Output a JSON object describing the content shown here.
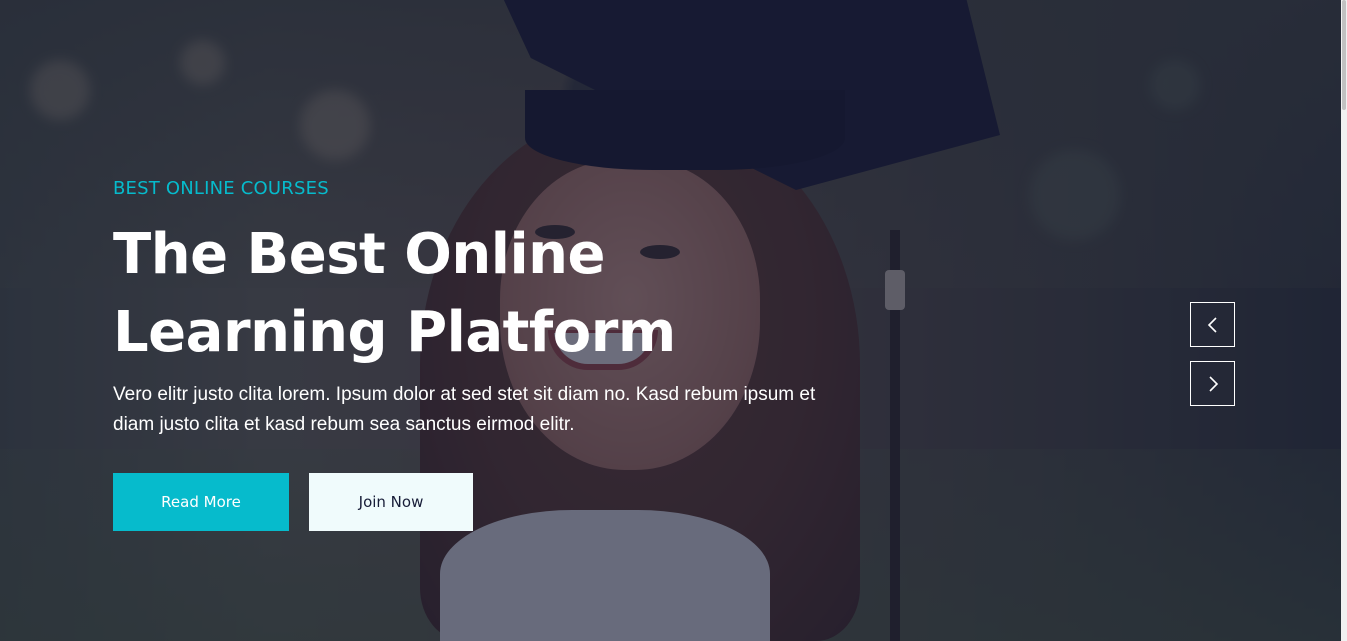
{
  "hero": {
    "eyebrow": "BEST ONLINE COURSES",
    "title": "The Best Online Learning Platform",
    "description": "Vero elitr justo clita lorem. Ipsum dolor at sed stet sit diam no. Kasd rebum ipsum et diam justo clita et kasd rebum sea sanctus eirmod elitr.",
    "primary_button": "Read More",
    "secondary_button": "Join Now",
    "background_image": "graduate-student-photo"
  },
  "carousel": {
    "prev_icon": "chevron-left-icon",
    "next_icon": "chevron-right-icon"
  },
  "colors": {
    "accent": "#06bbcc",
    "overlay": "#181d38",
    "light_button": "#f0fbfc",
    "text": "#ffffff"
  }
}
